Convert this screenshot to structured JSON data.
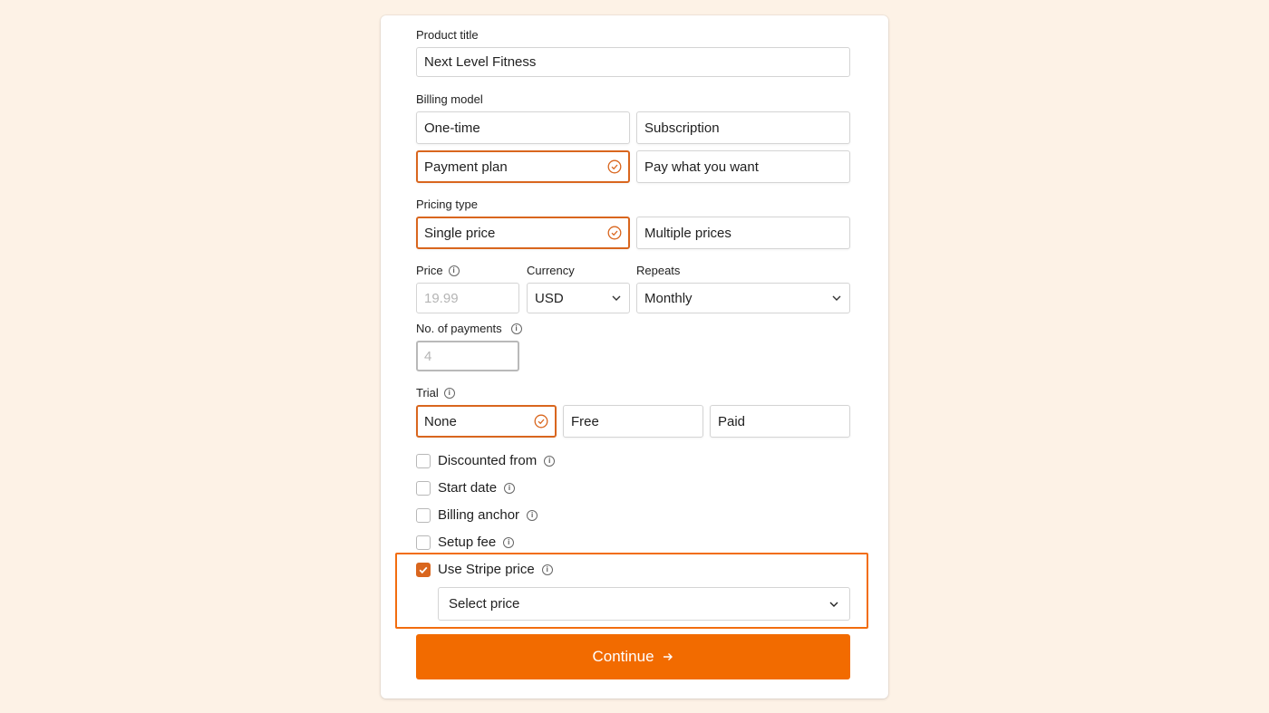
{
  "product": {
    "label": "Product title",
    "value": "Next Level Fitness"
  },
  "billing": {
    "label": "Billing model",
    "options": [
      "One-time",
      "Subscription",
      "Payment plan",
      "Pay what you want"
    ],
    "selected": "Payment plan"
  },
  "pricing": {
    "label": "Pricing type",
    "options": [
      "Single price",
      "Multiple prices"
    ],
    "selected": "Single price"
  },
  "price": {
    "label": "Price",
    "placeholder": "19.99"
  },
  "currency": {
    "label": "Currency",
    "value": "USD"
  },
  "repeats": {
    "label": "Repeats",
    "value": "Monthly"
  },
  "payments": {
    "label": "No. of payments",
    "placeholder": "4"
  },
  "trial": {
    "label": "Trial",
    "options": [
      "None",
      "Free",
      "Paid"
    ],
    "selected": "None"
  },
  "options": [
    {
      "label": "Discounted from",
      "checked": false
    },
    {
      "label": "Start date",
      "checked": false
    },
    {
      "label": "Billing anchor",
      "checked": false
    },
    {
      "label": "Setup fee",
      "checked": false
    },
    {
      "label": "Use Stripe price",
      "checked": true
    }
  ],
  "stripe_select": {
    "value": "Select price"
  },
  "continue": {
    "label": "Continue"
  },
  "colors": {
    "accent": "#d9661e",
    "button": "#f26b00",
    "background": "#fdf2e6"
  }
}
